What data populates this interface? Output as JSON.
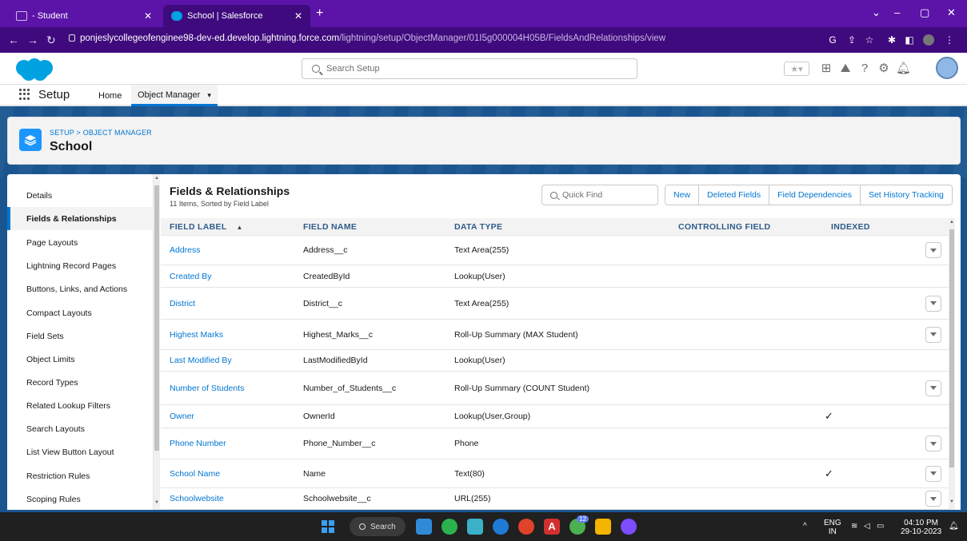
{
  "browser": {
    "tabs": [
      {
        "label": "- Student"
      },
      {
        "label": "School | Salesforce"
      }
    ],
    "url_host": "ponjeslycollegeofenginee98-dev-ed.develop.lightning.force.com",
    "url_path": "/lightning/setup/ObjectManager/01I5g000004H05B/FieldsAndRelationships/view"
  },
  "header": {
    "search_placeholder": "Search Setup"
  },
  "appnav": {
    "app_name": "Setup",
    "home": "Home",
    "object_manager": "Object Manager"
  },
  "object": {
    "breadcrumb": "SETUP > OBJECT MANAGER",
    "title": "School"
  },
  "leftnav": {
    "items": [
      {
        "label": "Details"
      },
      {
        "label": "Fields & Relationships"
      },
      {
        "label": "Page Layouts"
      },
      {
        "label": "Lightning Record Pages"
      },
      {
        "label": "Buttons, Links, and Actions"
      },
      {
        "label": "Compact Layouts"
      },
      {
        "label": "Field Sets"
      },
      {
        "label": "Object Limits"
      },
      {
        "label": "Record Types"
      },
      {
        "label": "Related Lookup Filters"
      },
      {
        "label": "Search Layouts"
      },
      {
        "label": "List View Button Layout"
      },
      {
        "label": "Restriction Rules"
      },
      {
        "label": "Scoping Rules"
      }
    ]
  },
  "main": {
    "title": "Fields & Relationships",
    "subtitle": "11 Items, Sorted by Field Label",
    "quick_find_placeholder": "Quick Find",
    "buttons": {
      "new": "New",
      "deleted_fields": "Deleted Fields",
      "field_dependencies": "Field Dependencies",
      "set_history_tracking": "Set History Tracking"
    },
    "columns": {
      "field_label": "FIELD LABEL",
      "field_name": "FIELD NAME",
      "data_type": "DATA TYPE",
      "controlling_field": "CONTROLLING FIELD",
      "indexed": "INDEXED"
    },
    "rows": [
      {
        "label": "Address",
        "name": "Address__c",
        "type": "Text Area(255)",
        "indexed": false,
        "menu": true
      },
      {
        "label": "Created By",
        "name": "CreatedById",
        "type": "Lookup(User)",
        "indexed": false,
        "menu": false
      },
      {
        "label": "District",
        "name": "District__c",
        "type": "Text Area(255)",
        "indexed": false,
        "menu": true
      },
      {
        "label": "Highest Marks",
        "name": "Highest_Marks__c",
        "type": "Roll-Up Summary (MAX Student)",
        "indexed": false,
        "menu": true
      },
      {
        "label": "Last Modified By",
        "name": "LastModifiedById",
        "type": "Lookup(User)",
        "indexed": false,
        "menu": false
      },
      {
        "label": "Number of Students",
        "name": "Number_of_Students__c",
        "type": "Roll-Up Summary (COUNT Student)",
        "indexed": false,
        "menu": true
      },
      {
        "label": "Owner",
        "name": "OwnerId",
        "type": "Lookup(User,Group)",
        "indexed": true,
        "menu": false
      },
      {
        "label": "Phone Number",
        "name": "Phone_Number__c",
        "type": "Phone",
        "indexed": false,
        "menu": true
      },
      {
        "label": "School Name",
        "name": "Name",
        "type": "Text(80)",
        "indexed": true,
        "menu": true
      },
      {
        "label": "Schoolwebsite",
        "name": "Schoolwebsite__c",
        "type": "URL(255)",
        "indexed": false,
        "menu": true
      }
    ]
  },
  "taskbar": {
    "search": "Search",
    "lang": "ENG",
    "region": "IN",
    "time": "04:10 PM",
    "date": "29-10-2023",
    "badge": "12"
  },
  "colors": {
    "tabbar": "#5c14a8",
    "addressbar": "#3f0a7d",
    "brand": "#0176d3",
    "banner": "#1a5590"
  }
}
